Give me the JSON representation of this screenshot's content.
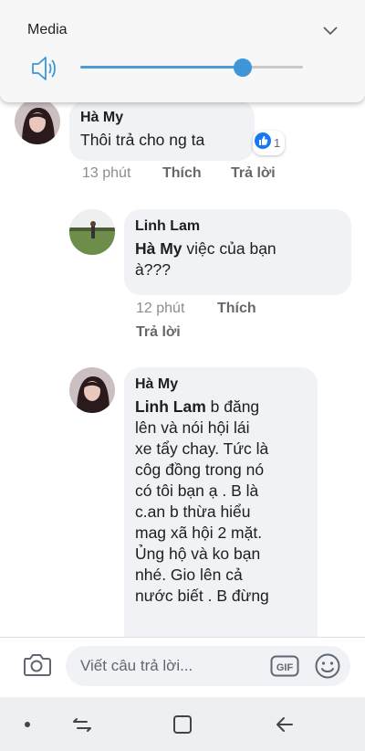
{
  "media_panel": {
    "title": "Media",
    "volume_percent": 73
  },
  "comments": [
    {
      "author": "Hà My",
      "text": "Thôi trả cho ng ta",
      "reaction_count": "1",
      "time": "13 phút",
      "like": "Thích",
      "reply": "Trả lời"
    },
    {
      "author": "Linh Lam",
      "mention": "Hà My",
      "text_line1": " việc của bạn",
      "text_line2": "à???",
      "time": "12 phút",
      "like": "Thích",
      "reply": "Trả lời"
    },
    {
      "author": "Hà My",
      "mention": "Linh Lam",
      "text_lines": [
        " b đăng",
        "lên và nói hội lái",
        "xe tẩy chay. Tức là",
        "côg đồng trong nó",
        "có tôi bạn ạ . B là",
        "c.an b thừa hiểu",
        "mag xã hội 2 mặt.",
        "Ủng hộ và ko bạn",
        "nhé.  Gio lên cả",
        "nước biết . B đừng"
      ]
    }
  ],
  "composer": {
    "placeholder": "Viết câu trả lời...",
    "gif_label": "GIF"
  },
  "colors": {
    "accent": "#3d96d8",
    "bubble": "#f0f2f5",
    "like_blue": "#1877f2"
  },
  "icons": [
    "speaker-icon",
    "chevron-down-icon",
    "like-reaction-icon",
    "camera-icon",
    "gif-icon",
    "emoji-icon",
    "recent-apps-icon",
    "home-icon",
    "back-icon"
  ]
}
